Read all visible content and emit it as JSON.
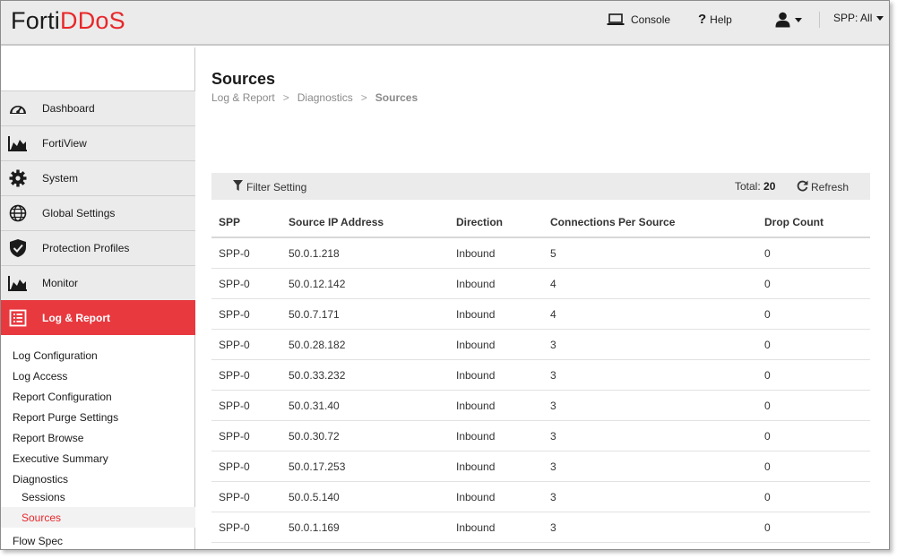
{
  "header": {
    "logo_part1": "Forti",
    "logo_part2": "DDoS",
    "console_label": "Console",
    "help_label": "Help",
    "spp_label": "SPP: All",
    "icons": {
      "console": "laptop-icon",
      "help": "question-mark-icon",
      "user": "user-icon"
    }
  },
  "sidebar": {
    "nav": [
      {
        "label": "Dashboard",
        "icon": "gauge-icon"
      },
      {
        "label": "FortiView",
        "icon": "area-chart-icon"
      },
      {
        "label": "System",
        "icon": "gear-icon"
      },
      {
        "label": "Global Settings",
        "icon": "globe-icon"
      },
      {
        "label": "Protection Profiles",
        "icon": "shield-icon"
      },
      {
        "label": "Monitor",
        "icon": "area-chart-icon"
      },
      {
        "label": "Log & Report",
        "icon": "list-icon",
        "active": true
      }
    ],
    "sub": [
      {
        "label": "Log Configuration"
      },
      {
        "label": "Log Access"
      },
      {
        "label": "Report Configuration"
      },
      {
        "label": "Report Purge Settings"
      },
      {
        "label": "Report Browse"
      },
      {
        "label": "Executive Summary"
      },
      {
        "label": "Diagnostics"
      },
      {
        "label": "Sessions"
      },
      {
        "label": "Sources",
        "selected": true
      },
      {
        "label": "Flow Spec"
      }
    ]
  },
  "main": {
    "title": "Sources",
    "breadcrumb": [
      "Log & Report",
      ">",
      "Diagnostics",
      ">",
      "Sources"
    ],
    "toolbar": {
      "filter_label": "Filter Setting",
      "total_label": "Total:",
      "total_value": "20",
      "refresh_label": "Refresh"
    },
    "table": {
      "columns": [
        "SPP",
        "Source IP Address",
        "Direction",
        "Connections Per Source",
        "Drop Count"
      ],
      "rows": [
        [
          "SPP-0",
          "50.0.1.218",
          "Inbound",
          "5",
          "0"
        ],
        [
          "SPP-0",
          "50.0.12.142",
          "Inbound",
          "4",
          "0"
        ],
        [
          "SPP-0",
          "50.0.7.171",
          "Inbound",
          "4",
          "0"
        ],
        [
          "SPP-0",
          "50.0.28.182",
          "Inbound",
          "3",
          "0"
        ],
        [
          "SPP-0",
          "50.0.33.232",
          "Inbound",
          "3",
          "0"
        ],
        [
          "SPP-0",
          "50.0.31.40",
          "Inbound",
          "3",
          "0"
        ],
        [
          "SPP-0",
          "50.0.30.72",
          "Inbound",
          "3",
          "0"
        ],
        [
          "SPP-0",
          "50.0.17.253",
          "Inbound",
          "3",
          "0"
        ],
        [
          "SPP-0",
          "50.0.5.140",
          "Inbound",
          "3",
          "0"
        ],
        [
          "SPP-0",
          "50.0.1.169",
          "Inbound",
          "3",
          "0"
        ]
      ]
    }
  },
  "colors": {
    "accent": "#e8393f",
    "logo_red": "#e8272b",
    "header_bg": "#ebebeb"
  }
}
